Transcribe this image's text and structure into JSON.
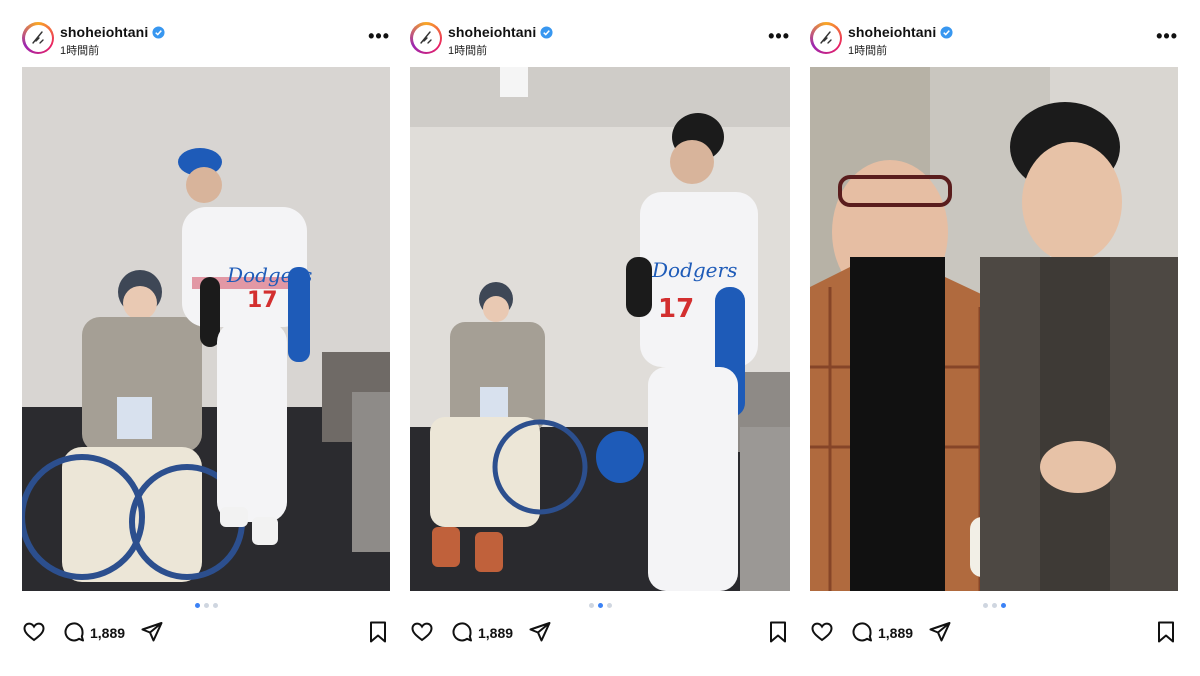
{
  "posts": [
    {
      "username": "shoheiohtani",
      "time": "1時間前",
      "comment_count": "1,889",
      "carousel": {
        "total": 3,
        "active": 1
      }
    },
    {
      "username": "shoheiohtani",
      "time": "1時間前",
      "comment_count": "1,889",
      "carousel": {
        "total": 3,
        "active": 2
      }
    },
    {
      "username": "shoheiohtani",
      "time": "1時間前",
      "comment_count": "1,889",
      "carousel": {
        "total": 3,
        "active": 3
      }
    }
  ],
  "icons": {
    "more": "more-options-icon",
    "like": "heart-icon",
    "comment": "comment-icon",
    "share": "share-icon",
    "save": "bookmark-icon",
    "verified": "verified-badge-icon"
  },
  "colors": {
    "dodgers_blue": "#1e5bb8",
    "verified_blue": "#3897f0",
    "carousel_active": "#3b82f6"
  }
}
